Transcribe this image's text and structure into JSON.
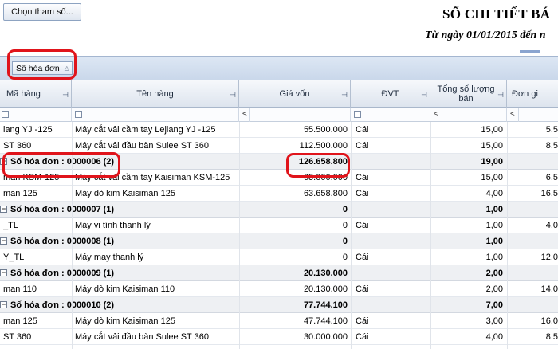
{
  "toolbar": {
    "choose_params_label": "Chọn tham số..."
  },
  "report": {
    "title": "SỔ CHI TIẾT BÁ",
    "subtitle": "Từ ngày 01/01/2015 đến n"
  },
  "group_panel": {
    "group_by_label": "Số hóa đơn"
  },
  "columns": {
    "ma_hang": "Mã hàng",
    "ten_hang": "Tên hàng",
    "gia_von": "Giá vốn",
    "dvt": "ĐVT",
    "tong_so_luong_ban": "Tổng số lượng bán",
    "don_gia": "Đơn gi"
  },
  "filter": {
    "operator": "≤"
  },
  "rows": [
    {
      "ma_hang": "iang YJ -125",
      "ten_hang": "Máy cắt vải cầm tay Lejiang YJ -125",
      "gia_von": "55.500.000",
      "dvt": "Cái",
      "so_luong": "15,00",
      "don_gia": "5.5"
    },
    {
      "ma_hang": "ST 360",
      "ten_hang": "Máy cắt vải đầu bàn Sulee ST 360",
      "gia_von": "112.500.000",
      "dvt": "Cái",
      "so_luong": "15,00",
      "don_gia": "8.5"
    },
    {
      "group_label": "Số hóa đơn : 0000006 (2)",
      "gia_von": "126.658.800",
      "so_luong": "19,00"
    },
    {
      "ma_hang": "man KSM-125",
      "ten_hang": "Máy cắt vải cầm tay Kaisiman KSM-125",
      "gia_von": "63.000.000",
      "dvt": "Cái",
      "so_luong": "15,00",
      "don_gia": "6.5"
    },
    {
      "ma_hang": "man 125",
      "ten_hang": "Máy dò kim Kaisiman 125",
      "gia_von": "63.658.800",
      "dvt": "Cái",
      "so_luong": "4,00",
      "don_gia": "16.5"
    },
    {
      "group_label": "Số hóa đơn : 0000007 (1)",
      "gia_von": "0",
      "so_luong": "1,00"
    },
    {
      "ma_hang": "_TL",
      "ten_hang": "Máy vi tính thanh lý",
      "gia_von": "0",
      "dvt": "Cái",
      "so_luong": "1,00",
      "don_gia": "4.0"
    },
    {
      "group_label": "Số hóa đơn : 0000008 (1)",
      "gia_von": "0",
      "so_luong": "1,00"
    },
    {
      "ma_hang": "Y_TL",
      "ten_hang": "Máy may thanh lý",
      "gia_von": "0",
      "dvt": "Cái",
      "so_luong": "1,00",
      "don_gia": "12.0"
    },
    {
      "group_label": "Số hóa đơn : 0000009 (1)",
      "gia_von": "20.130.000",
      "so_luong": "2,00"
    },
    {
      "ma_hang": "man 110",
      "ten_hang": "Máy dò kim Kaisiman 110",
      "gia_von": "20.130.000",
      "dvt": "Cái",
      "so_luong": "2,00",
      "don_gia": "14.0"
    },
    {
      "group_label": "Số hóa đơn : 0000010 (2)",
      "gia_von": "77.744.100",
      "so_luong": "7,00"
    },
    {
      "ma_hang": "man 125",
      "ten_hang": "Máy dò kim Kaisiman 125",
      "gia_von": "47.744.100",
      "dvt": "Cái",
      "so_luong": "3,00",
      "don_gia": "16.0"
    },
    {
      "ma_hang": "ST 360",
      "ten_hang": "Máy cắt vải đầu bàn Sulee ST 360",
      "gia_von": "30.000.000",
      "dvt": "Cái",
      "so_luong": "4,00",
      "don_gia": "8.5"
    }
  ]
}
